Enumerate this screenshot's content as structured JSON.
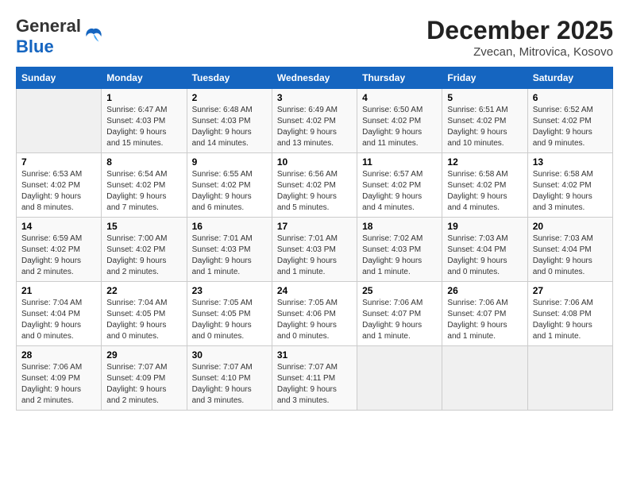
{
  "logo": {
    "general": "General",
    "blue": "Blue"
  },
  "header": {
    "month": "December 2025",
    "location": "Zvecan, Mitrovica, Kosovo"
  },
  "days_of_week": [
    "Sunday",
    "Monday",
    "Tuesday",
    "Wednesday",
    "Thursday",
    "Friday",
    "Saturday"
  ],
  "weeks": [
    [
      {
        "day": "",
        "sunrise": "",
        "sunset": "",
        "daylight": ""
      },
      {
        "day": "1",
        "sunrise": "Sunrise: 6:47 AM",
        "sunset": "Sunset: 4:03 PM",
        "daylight": "Daylight: 9 hours and 15 minutes."
      },
      {
        "day": "2",
        "sunrise": "Sunrise: 6:48 AM",
        "sunset": "Sunset: 4:03 PM",
        "daylight": "Daylight: 9 hours and 14 minutes."
      },
      {
        "day": "3",
        "sunrise": "Sunrise: 6:49 AM",
        "sunset": "Sunset: 4:02 PM",
        "daylight": "Daylight: 9 hours and 13 minutes."
      },
      {
        "day": "4",
        "sunrise": "Sunrise: 6:50 AM",
        "sunset": "Sunset: 4:02 PM",
        "daylight": "Daylight: 9 hours and 11 minutes."
      },
      {
        "day": "5",
        "sunrise": "Sunrise: 6:51 AM",
        "sunset": "Sunset: 4:02 PM",
        "daylight": "Daylight: 9 hours and 10 minutes."
      },
      {
        "day": "6",
        "sunrise": "Sunrise: 6:52 AM",
        "sunset": "Sunset: 4:02 PM",
        "daylight": "Daylight: 9 hours and 9 minutes."
      }
    ],
    [
      {
        "day": "7",
        "sunrise": "Sunrise: 6:53 AM",
        "sunset": "Sunset: 4:02 PM",
        "daylight": "Daylight: 9 hours and 8 minutes."
      },
      {
        "day": "8",
        "sunrise": "Sunrise: 6:54 AM",
        "sunset": "Sunset: 4:02 PM",
        "daylight": "Daylight: 9 hours and 7 minutes."
      },
      {
        "day": "9",
        "sunrise": "Sunrise: 6:55 AM",
        "sunset": "Sunset: 4:02 PM",
        "daylight": "Daylight: 9 hours and 6 minutes."
      },
      {
        "day": "10",
        "sunrise": "Sunrise: 6:56 AM",
        "sunset": "Sunset: 4:02 PM",
        "daylight": "Daylight: 9 hours and 5 minutes."
      },
      {
        "day": "11",
        "sunrise": "Sunrise: 6:57 AM",
        "sunset": "Sunset: 4:02 PM",
        "daylight": "Daylight: 9 hours and 4 minutes."
      },
      {
        "day": "12",
        "sunrise": "Sunrise: 6:58 AM",
        "sunset": "Sunset: 4:02 PM",
        "daylight": "Daylight: 9 hours and 4 minutes."
      },
      {
        "day": "13",
        "sunrise": "Sunrise: 6:58 AM",
        "sunset": "Sunset: 4:02 PM",
        "daylight": "Daylight: 9 hours and 3 minutes."
      }
    ],
    [
      {
        "day": "14",
        "sunrise": "Sunrise: 6:59 AM",
        "sunset": "Sunset: 4:02 PM",
        "daylight": "Daylight: 9 hours and 2 minutes."
      },
      {
        "day": "15",
        "sunrise": "Sunrise: 7:00 AM",
        "sunset": "Sunset: 4:02 PM",
        "daylight": "Daylight: 9 hours and 2 minutes."
      },
      {
        "day": "16",
        "sunrise": "Sunrise: 7:01 AM",
        "sunset": "Sunset: 4:03 PM",
        "daylight": "Daylight: 9 hours and 1 minute."
      },
      {
        "day": "17",
        "sunrise": "Sunrise: 7:01 AM",
        "sunset": "Sunset: 4:03 PM",
        "daylight": "Daylight: 9 hours and 1 minute."
      },
      {
        "day": "18",
        "sunrise": "Sunrise: 7:02 AM",
        "sunset": "Sunset: 4:03 PM",
        "daylight": "Daylight: 9 hours and 1 minute."
      },
      {
        "day": "19",
        "sunrise": "Sunrise: 7:03 AM",
        "sunset": "Sunset: 4:04 PM",
        "daylight": "Daylight: 9 hours and 0 minutes."
      },
      {
        "day": "20",
        "sunrise": "Sunrise: 7:03 AM",
        "sunset": "Sunset: 4:04 PM",
        "daylight": "Daylight: 9 hours and 0 minutes."
      }
    ],
    [
      {
        "day": "21",
        "sunrise": "Sunrise: 7:04 AM",
        "sunset": "Sunset: 4:04 PM",
        "daylight": "Daylight: 9 hours and 0 minutes."
      },
      {
        "day": "22",
        "sunrise": "Sunrise: 7:04 AM",
        "sunset": "Sunset: 4:05 PM",
        "daylight": "Daylight: 9 hours and 0 minutes."
      },
      {
        "day": "23",
        "sunrise": "Sunrise: 7:05 AM",
        "sunset": "Sunset: 4:05 PM",
        "daylight": "Daylight: 9 hours and 0 minutes."
      },
      {
        "day": "24",
        "sunrise": "Sunrise: 7:05 AM",
        "sunset": "Sunset: 4:06 PM",
        "daylight": "Daylight: 9 hours and 0 minutes."
      },
      {
        "day": "25",
        "sunrise": "Sunrise: 7:06 AM",
        "sunset": "Sunset: 4:07 PM",
        "daylight": "Daylight: 9 hours and 1 minute."
      },
      {
        "day": "26",
        "sunrise": "Sunrise: 7:06 AM",
        "sunset": "Sunset: 4:07 PM",
        "daylight": "Daylight: 9 hours and 1 minute."
      },
      {
        "day": "27",
        "sunrise": "Sunrise: 7:06 AM",
        "sunset": "Sunset: 4:08 PM",
        "daylight": "Daylight: 9 hours and 1 minute."
      }
    ],
    [
      {
        "day": "28",
        "sunrise": "Sunrise: 7:06 AM",
        "sunset": "Sunset: 4:09 PM",
        "daylight": "Daylight: 9 hours and 2 minutes."
      },
      {
        "day": "29",
        "sunrise": "Sunrise: 7:07 AM",
        "sunset": "Sunset: 4:09 PM",
        "daylight": "Daylight: 9 hours and 2 minutes."
      },
      {
        "day": "30",
        "sunrise": "Sunrise: 7:07 AM",
        "sunset": "Sunset: 4:10 PM",
        "daylight": "Daylight: 9 hours and 3 minutes."
      },
      {
        "day": "31",
        "sunrise": "Sunrise: 7:07 AM",
        "sunset": "Sunset: 4:11 PM",
        "daylight": "Daylight: 9 hours and 3 minutes."
      },
      {
        "day": "",
        "sunrise": "",
        "sunset": "",
        "daylight": ""
      },
      {
        "day": "",
        "sunrise": "",
        "sunset": "",
        "daylight": ""
      },
      {
        "day": "",
        "sunrise": "",
        "sunset": "",
        "daylight": ""
      }
    ]
  ]
}
